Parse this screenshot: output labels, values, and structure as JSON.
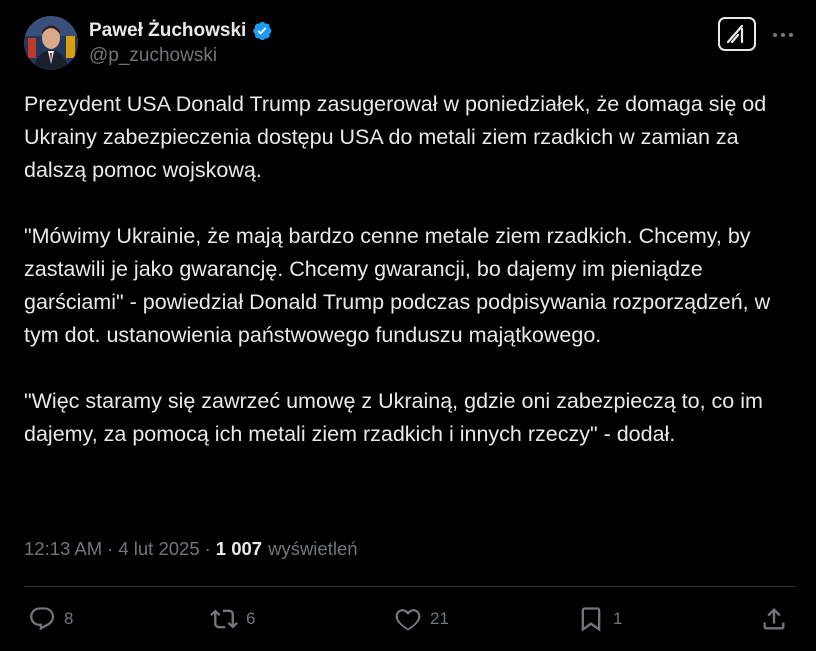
{
  "author": {
    "display_name": "Paweł Żuchowski",
    "handle": "@p_zuchowski",
    "verified": true
  },
  "tweet": {
    "paragraphs": [
      "Prezydent USA Donald Trump zasugerował w poniedziałek, że domaga się od Ukrainy zabezpieczenia dostępu USA do metali ziem rzadkich w zamian za dalszą pomoc wojskową.",
      "\"Mówimy Ukrainie, że mają bardzo cenne metale ziem rzadkich. Chcemy, by zastawili je jako gwarancję. Chcemy gwarancji, bo dajemy im pieniądze garściami\" - powiedział Donald Trump podczas podpisywania rozporządzeń, w tym dot. ustanowienia państwowego funduszu majątkowego.",
      "\"Więc staramy się zawrzeć umowę z Ukrainą, gdzie oni zabezpieczą to, co im dajemy, za pomocą ich metali ziem rzadkich i innych rzeczy\" - dodał."
    ]
  },
  "meta": {
    "time": "12:13 AM",
    "separator": "·",
    "date": "4 lut 2025",
    "views_count": "1 007",
    "views_label": "wyświetleń"
  },
  "actions": {
    "replies": "8",
    "reposts": "6",
    "likes": "21",
    "bookmarks": "1"
  },
  "icons": {
    "verified": "verified-badge-icon",
    "grok": "grok-icon",
    "more": "more-icon",
    "reply": "reply-icon",
    "repost": "repost-icon",
    "like": "heart-icon",
    "bookmark": "bookmark-icon",
    "share": "share-icon"
  },
  "colors": {
    "background": "#000000",
    "text": "#e7e9ea",
    "secondary": "#71767b",
    "verified": "#1d9bf0",
    "divider": "#2f3336"
  }
}
